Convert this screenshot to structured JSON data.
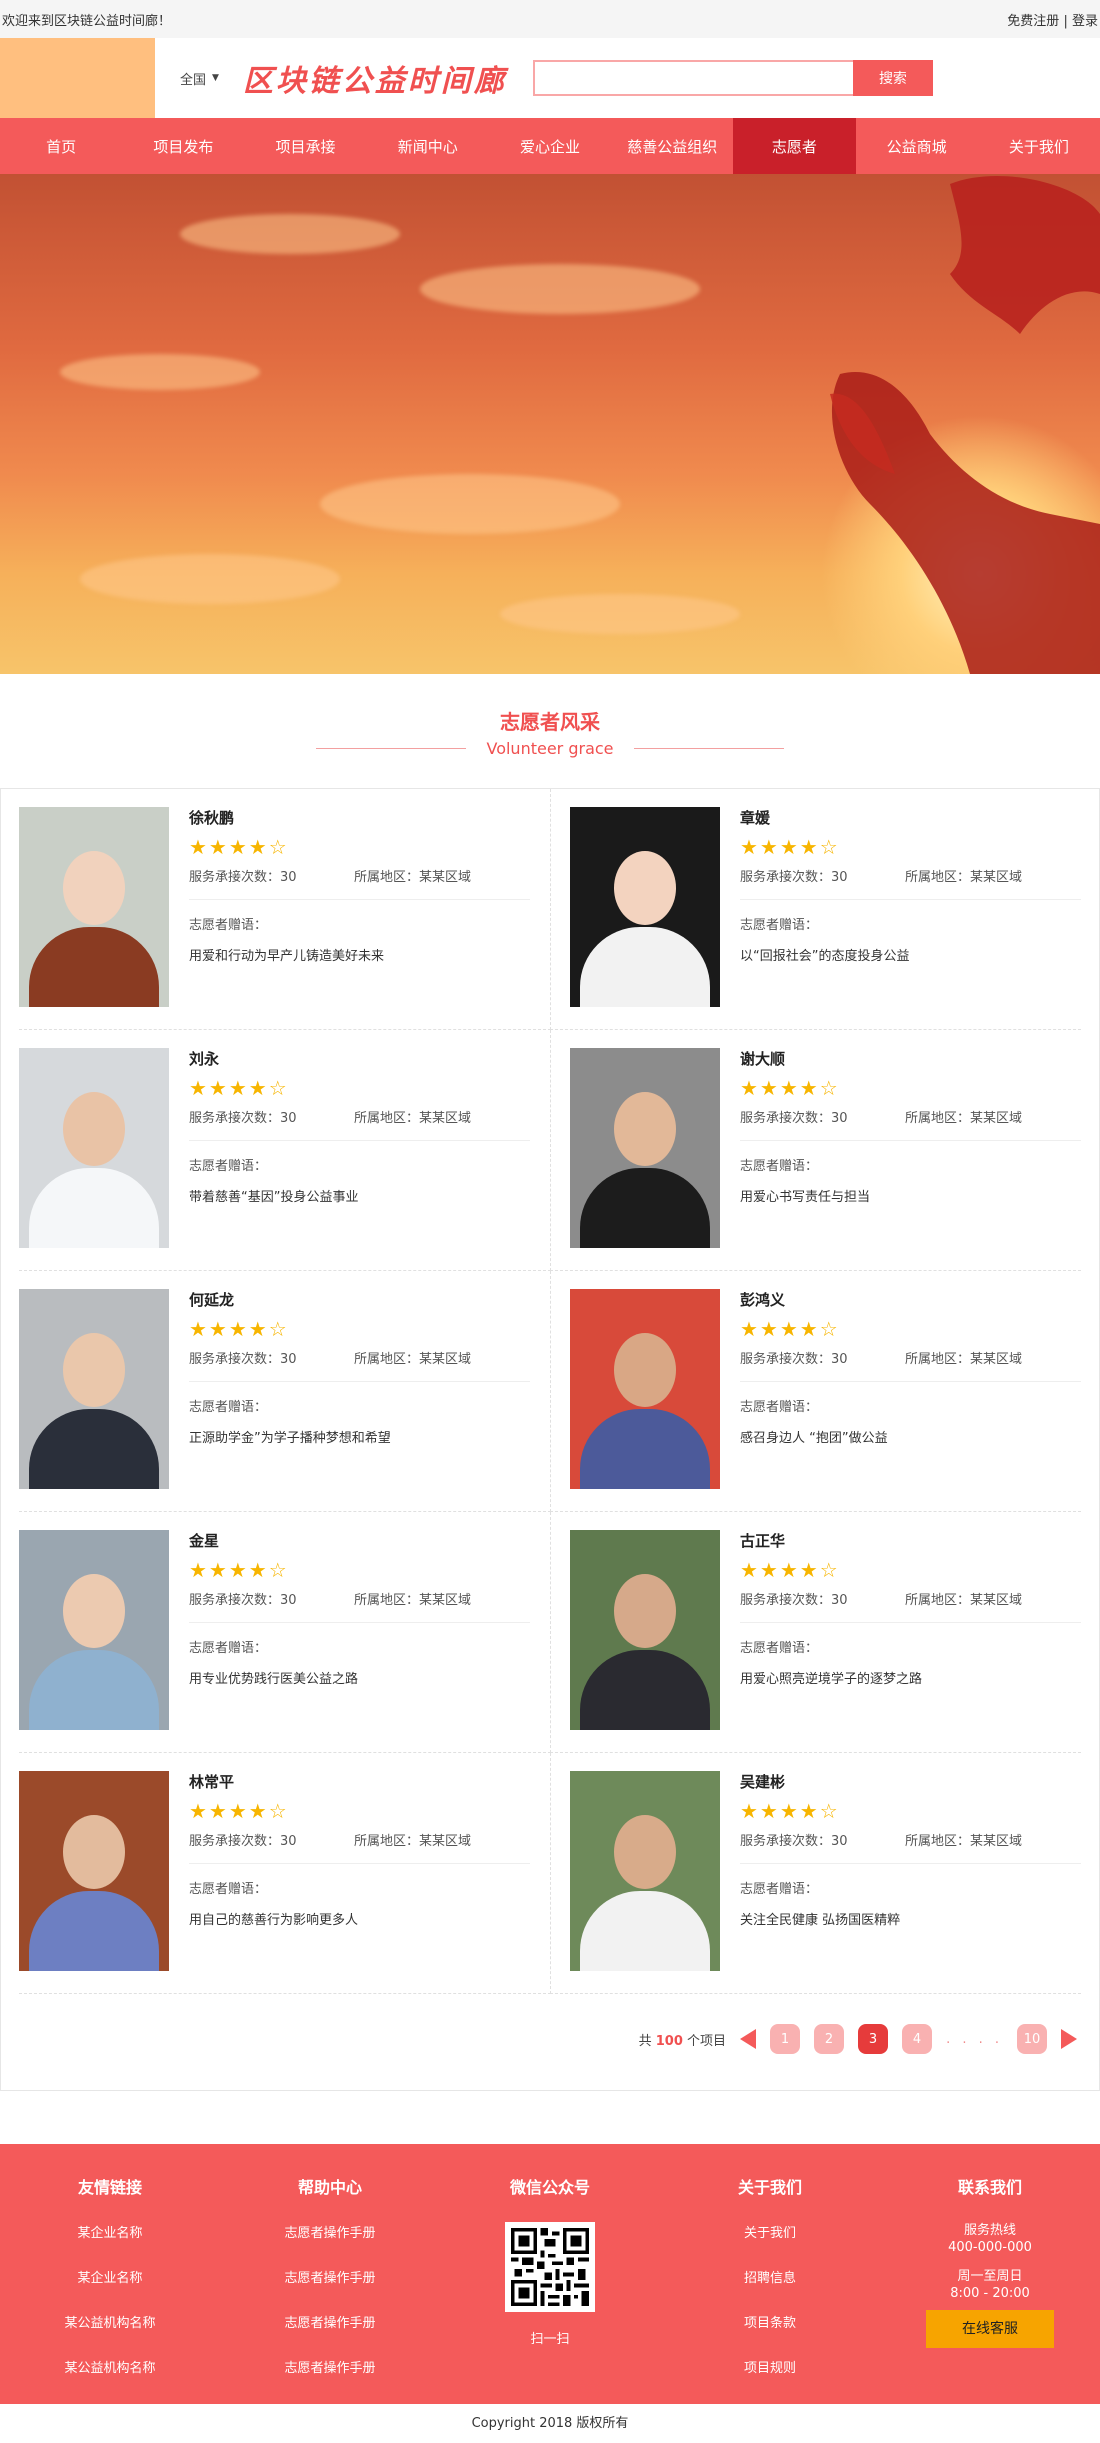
{
  "topbar": {
    "welcome": "欢迎来到区块链公益时间廊！",
    "register": "免费注册",
    "sep": "|",
    "login": "登录"
  },
  "header": {
    "region": "全国",
    "region_arrow": "▼",
    "brand": "区块链公益时间廊",
    "search_placeholder": "",
    "search_button": "搜索"
  },
  "nav": [
    {
      "label": "首页",
      "active": false
    },
    {
      "label": "项目发布",
      "active": false
    },
    {
      "label": "项目承接",
      "active": false
    },
    {
      "label": "新闻中心",
      "active": false
    },
    {
      "label": "爱心企业",
      "active": false
    },
    {
      "label": "慈善公益组织",
      "active": false
    },
    {
      "label": "志愿者",
      "active": true
    },
    {
      "label": "公益商城",
      "active": false
    },
    {
      "label": "关于我们",
      "active": false
    }
  ],
  "section": {
    "title_cn": "志愿者风采",
    "title_en": "Volunteer grace"
  },
  "volunteers": [
    {
      "name": "徐秋鹏",
      "stars": "★★★★☆",
      "count": "服务承接次数：30",
      "area": "所属地区：某某区域",
      "quote_label": "志愿者赠语：",
      "quote": "用爱和行动为早产儿铸造美好未来",
      "bg": "#c9cfc7",
      "skin": "#f1d2bd",
      "cloth": "#8a3b22"
    },
    {
      "name": "章媛",
      "stars": "★★★★☆",
      "count": "服务承接次数：30",
      "area": "所属地区：某某区域",
      "quote_label": "志愿者赠语：",
      "quote": "以“回报社会”的态度投身公益",
      "bg": "#1a1a1a",
      "skin": "#f3d3bf",
      "cloth": "#f2f2f2"
    },
    {
      "name": "刘永",
      "stars": "★★★★☆",
      "count": "服务承接次数：30",
      "area": "所属地区：某某区域",
      "quote_label": "志愿者赠语：",
      "quote": "带着慈善“基因”投身公益事业",
      "bg": "#d6d9dc",
      "skin": "#e9c3a6",
      "cloth": "#f5f7f9"
    },
    {
      "name": "谢大顺",
      "stars": "★★★★☆",
      "count": "服务承接次数：30",
      "area": "所属地区：某某区域",
      "quote_label": "志愿者赠语：",
      "quote": "用爱心书写责任与担当",
      "bg": "#8c8c8c",
      "skin": "#e2b898",
      "cloth": "#1c1c1c"
    },
    {
      "name": "何延龙",
      "stars": "★★★★☆",
      "count": "服务承接次数：30",
      "area": "所属地区：某某区域",
      "quote_label": "志愿者赠语：",
      "quote": "正源助学金”为学子播种梦想和希望",
      "bg": "#b9bcbf",
      "skin": "#eac7ab",
      "cloth": "#2a2f3a"
    },
    {
      "name": "彭鸿义",
      "stars": "★★★★☆",
      "count": "服务承接次数：30",
      "area": "所属地区：某某区域",
      "quote_label": "志愿者赠语：",
      "quote": "感召身边人 “抱团”做公益",
      "bg": "#d84a3a",
      "skin": "#d9a785",
      "cloth": "#4c5a9a"
    },
    {
      "name": "金星",
      "stars": "★★★★☆",
      "count": "服务承接次数：30",
      "area": "所属地区：某某区域",
      "quote_label": "志愿者赠语：",
      "quote": "用专业优势践行医美公益之路",
      "bg": "#9aa6b0",
      "skin": "#eccab0",
      "cloth": "#8fb1cf"
    },
    {
      "name": "古正华",
      "stars": "★★★★☆",
      "count": "服务承接次数：30",
      "area": "所属地区：某某区域",
      "quote_label": "志愿者赠语：",
      "quote": "用爱心照亮逆境学子的逐梦之路",
      "bg": "#5f7a4e",
      "skin": "#d6a98a",
      "cloth": "#2a2a30"
    },
    {
      "name": "林常平",
      "stars": "★★★★☆",
      "count": "服务承接次数：30",
      "area": "所属地区：某某区域",
      "quote_label": "志愿者赠语：",
      "quote": "用自己的慈善行为影响更多人",
      "bg": "#9b4a2a",
      "skin": "#e3bb9d",
      "cloth": "#6d7fc2"
    },
    {
      "name": "吴建彬",
      "stars": "★★★★☆",
      "count": "服务承接次数：30",
      "area": "所属地区：某某区域",
      "quote_label": "志愿者赠语：",
      "quote": "关注全民健康 弘扬国医精粹",
      "bg": "#6e8a5a",
      "skin": "#d8ab8a",
      "cloth": "#f2f2f2"
    }
  ],
  "pager": {
    "total_prefix": "共",
    "total": "100",
    "total_suffix": "个项目",
    "pages": [
      "1",
      "2",
      "3",
      "4"
    ],
    "current": "3",
    "dots": ". . . .",
    "last": "10"
  },
  "footer": {
    "links": {
      "title": "友情链接",
      "items": [
        "某企业名称",
        "某企业名称",
        "某公益机构名称",
        "某公益机构名称"
      ]
    },
    "help": {
      "title": "帮助中心",
      "items": [
        "志愿者操作手册",
        "志愿者操作手册",
        "志愿者操作手册",
        "志愿者操作手册"
      ]
    },
    "wechat": {
      "title": "微信公众号",
      "scan": "扫一扫"
    },
    "about": {
      "title": "关于我们",
      "items": [
        "关于我们",
        "招聘信息",
        "项目条款",
        "项目规则"
      ]
    },
    "contact": {
      "title": "联系我们",
      "hotline_label": "服务热线",
      "hotline": "400-000-000",
      "hours_label": "周一至周日",
      "hours": "8:00 - 20:00",
      "service_button": "在线客服"
    }
  },
  "copyright": "Copyright 2018 版权所有"
}
